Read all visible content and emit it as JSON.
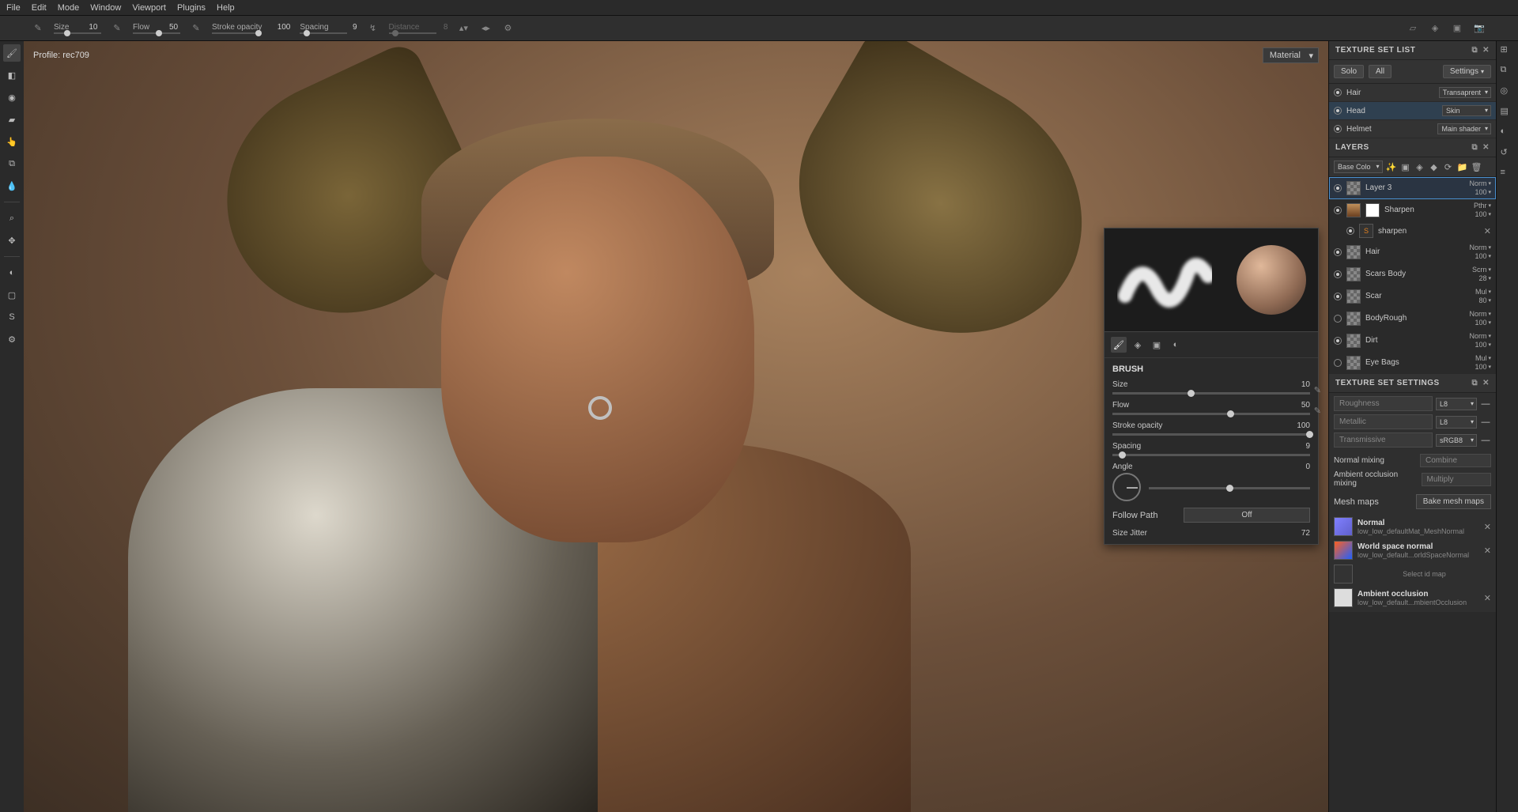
{
  "menubar": [
    "File",
    "Edit",
    "Mode",
    "Window",
    "Viewport",
    "Plugins",
    "Help"
  ],
  "options": {
    "size": {
      "label": "Size",
      "value": "10"
    },
    "flow": {
      "label": "Flow",
      "value": "50"
    },
    "stroke_opacity": {
      "label": "Stroke opacity",
      "value": "100"
    },
    "spacing": {
      "label": "Spacing",
      "value": "9"
    },
    "distance": {
      "label": "Distance",
      "value": "8"
    }
  },
  "viewport": {
    "profile": "Profile: rec709",
    "material_dd": "Material"
  },
  "brush_panel": {
    "header": "BRUSH",
    "size": {
      "label": "Size",
      "value": "10",
      "pct": 40
    },
    "flow": {
      "label": "Flow",
      "value": "50",
      "pct": 60
    },
    "stroke_opacity": {
      "label": "Stroke opacity",
      "value": "100",
      "pct": 100
    },
    "spacing": {
      "label": "Spacing",
      "value": "9",
      "pct": 5
    },
    "angle": {
      "label": "Angle",
      "value": "0",
      "pct": 50
    },
    "follow_path": {
      "label": "Follow Path",
      "button": "Off"
    },
    "size_jitter": {
      "label": "Size Jitter",
      "value": "72"
    }
  },
  "texture_set_list": {
    "title": "TEXTURE SET LIST",
    "solo": "Solo",
    "all": "All",
    "settings": "Settings",
    "rows": [
      {
        "name": "Hair",
        "shader": "Transaprent",
        "on": true,
        "selected": false
      },
      {
        "name": "Head",
        "shader": "Skin",
        "on": true,
        "selected": true
      },
      {
        "name": "Helmet",
        "shader": "Main shader",
        "on": true,
        "selected": false
      }
    ]
  },
  "layers": {
    "title": "LAYERS",
    "channel": "Base Colo",
    "items": [
      {
        "name": "Layer 3",
        "blend": "Norm",
        "opacity": "100",
        "on": true,
        "selected": true,
        "thumbs": [
          "checker"
        ]
      },
      {
        "name": "Sharpen",
        "blend": "Pthr",
        "opacity": "100",
        "on": true,
        "thumbs": [
          "img",
          "mask"
        ]
      },
      {
        "name": "sharpen",
        "sub": true,
        "on": true,
        "thumbs": [
          "fx"
        ],
        "x": true
      },
      {
        "name": "Hair",
        "blend": "Norm",
        "opacity": "100",
        "on": true,
        "thumbs": [
          "checker"
        ]
      },
      {
        "name": "Scars Body",
        "blend": "Scrn",
        "opacity": "28",
        "on": true,
        "thumbs": [
          "checker"
        ]
      },
      {
        "name": "Scar",
        "blend": "Mul",
        "opacity": "80",
        "on": true,
        "thumbs": [
          "checker"
        ]
      },
      {
        "name": "BodyRough",
        "blend": "Norm",
        "opacity": "100",
        "on": false,
        "thumbs": [
          "checker"
        ]
      },
      {
        "name": "Dirt",
        "blend": "Norm",
        "opacity": "100",
        "on": true,
        "thumbs": [
          "checker"
        ]
      },
      {
        "name": "Eye Bags",
        "blend": "Mul",
        "opacity": "100",
        "on": false,
        "thumbs": [
          "checker"
        ]
      }
    ]
  },
  "texture_set_settings": {
    "title": "TEXTURE SET SETTINGS",
    "channels": [
      {
        "name": "Roughness",
        "format": "L8"
      },
      {
        "name": "Metallic",
        "format": "L8"
      },
      {
        "name": "Transmissive",
        "format": "sRGB8"
      }
    ],
    "normal_mixing": {
      "label": "Normal mixing",
      "value": "Combine"
    },
    "ao_mixing": {
      "label": "Ambient occlusion mixing",
      "value": "Multiply"
    },
    "mesh_maps_label": "Mesh maps",
    "bake_button": "Bake mesh maps",
    "maps": [
      {
        "title": "Normal",
        "sub": "low_low_defaultMat_MeshNormal",
        "cls": "normal"
      },
      {
        "title": "World space normal",
        "sub": "low_low_default...orldSpaceNormal",
        "cls": "wsn"
      },
      {
        "title": "Select id map",
        "id_select": true
      },
      {
        "title": "Ambient occlusion",
        "sub": "low_low_default...mbientOcclusion",
        "cls": "ao"
      }
    ]
  }
}
